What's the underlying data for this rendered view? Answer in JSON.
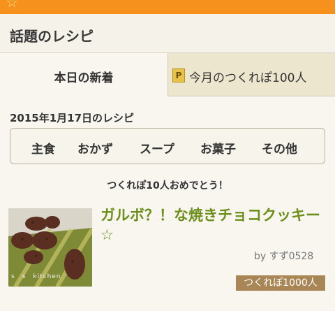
{
  "section": {
    "title": "話題のレシピ"
  },
  "tabs": [
    {
      "label": "本日の新着"
    },
    {
      "label": "今月のつくれぽ100人",
      "badge": "P"
    }
  ],
  "date_heading": "2015年1月17日のレシピ",
  "categories": [
    "主食",
    "おかず",
    "スープ",
    "お菓子",
    "その他"
  ],
  "congrats": "つくれぽ10人おめでとう！",
  "recipe": {
    "title": "ガルボ？！な焼きチョコクッキー☆",
    "author": "by すず0528",
    "badge": "つくれぽ1000人",
    "image_caption": "s　s　kitchen"
  },
  "colors": {
    "topbar": "#f7911e",
    "title_green": "#6c8f1c",
    "badge_brown": "#a88656"
  }
}
